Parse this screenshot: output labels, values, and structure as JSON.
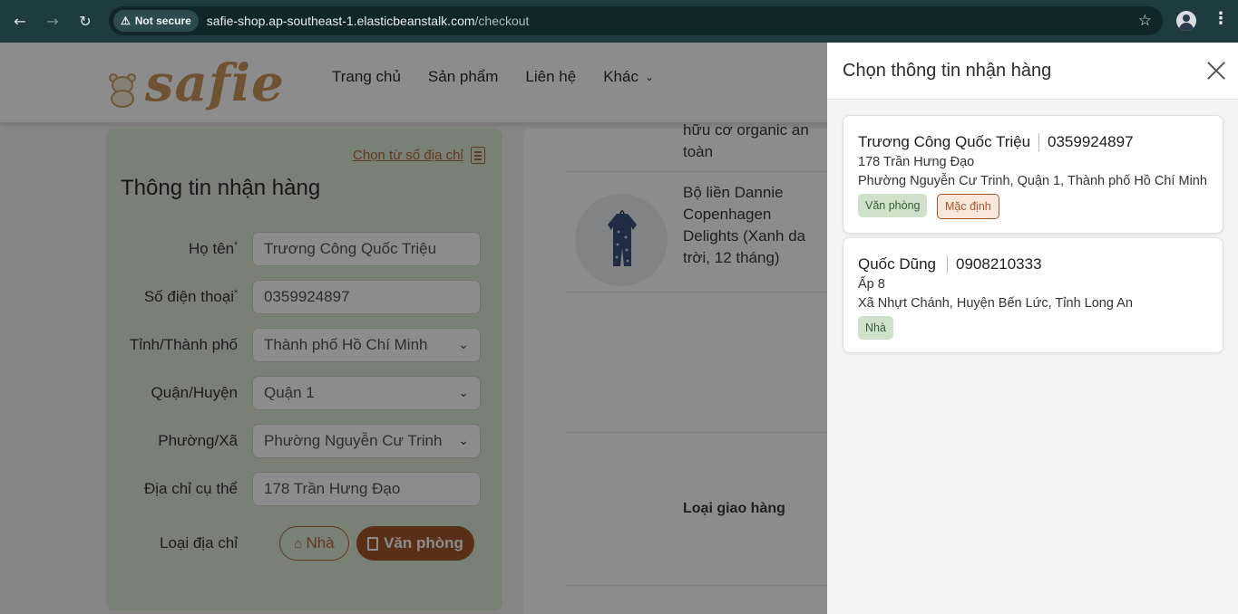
{
  "browser": {
    "not_secure_label": "Not secure",
    "url_host": "safie-shop.ap-southeast-1.elasticbeanstalk.com",
    "url_path": "/checkout"
  },
  "site": {
    "logo_text": "safie",
    "menu": [
      {
        "label": "Trang chủ"
      },
      {
        "label": "Sản phẩm"
      },
      {
        "label": "Liên hệ"
      },
      {
        "label": "Khác"
      }
    ]
  },
  "form": {
    "choose_link": "Chọn từ sổ địa chỉ",
    "title": "Thông tin nhận hàng",
    "name_label": "Họ tên",
    "name_value": "Trương Công Quốc Triệu",
    "phone_label": "Số điện thoại",
    "phone_value": "0359924897",
    "city_label": "Tỉnh/Thành phố",
    "city_value": "Thành phố Hồ Chí Minh",
    "district_label": "Quận/Huyện",
    "district_value": "Quận 1",
    "ward_label": "Phường/Xã",
    "ward_value": "Phường Nguyễn Cư Trinh",
    "address_label": "Địa chỉ cụ thể",
    "address_value": "178 Trần Hưng Đạo",
    "type_label": "Loại địa chỉ",
    "type_home": "Nhà",
    "type_office": "Văn phòng",
    "required_mark": "*"
  },
  "order": {
    "product1_line1": "hữu cơ organic an",
    "product1_line2": "toàn",
    "product2_line1": "Bộ liền Dannie",
    "product2_line2": "Copenhagen",
    "product2_line3": "Delights (Xanh da",
    "product2_line4": "trời, 12 tháng)",
    "shipping_label": "Loại giao hàng"
  },
  "drawer": {
    "title": "Chọn thông tin nhận hàng",
    "addresses": [
      {
        "name": "Trương Công Quốc Triệu",
        "phone": "0359924897",
        "street": "178 Trần Hưng Đạo",
        "region": "Phường Nguyễn Cư Trinh, Quận 1, Thành phố Hồ Chí Minh",
        "type": "Văn phòng",
        "default": "Mặc định"
      },
      {
        "name": "Quốc Dũng",
        "phone": "0908210333",
        "street": "Ấp 8",
        "region": "Xã Nhựt Chánh, Huyện Bến Lức, Tỉnh Long An",
        "type": "Nhà"
      }
    ]
  }
}
